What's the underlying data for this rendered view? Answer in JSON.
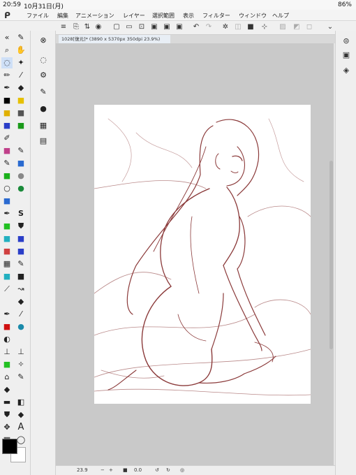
{
  "status": {
    "time": "20:59",
    "date": "10月31日(月)",
    "battery": "86%"
  },
  "menu": [
    "ファイル",
    "編集",
    "アニメーション",
    "レイヤー",
    "選択範囲",
    "表示",
    "フィルター",
    "ウィンドウ",
    "ヘルプ"
  ],
  "tab": {
    "title": "1028[復元]* (3890 x 5370px 350dpi 23.9%)"
  },
  "bottom": {
    "zoom": "23.9",
    "angle": "0.0"
  },
  "colors": {
    "accent": "#3a78d6",
    "line": "#8b3a3a",
    "canvas_bg": "#c9c9c9",
    "fg": "#000000",
    "bg": "#ffffff"
  }
}
